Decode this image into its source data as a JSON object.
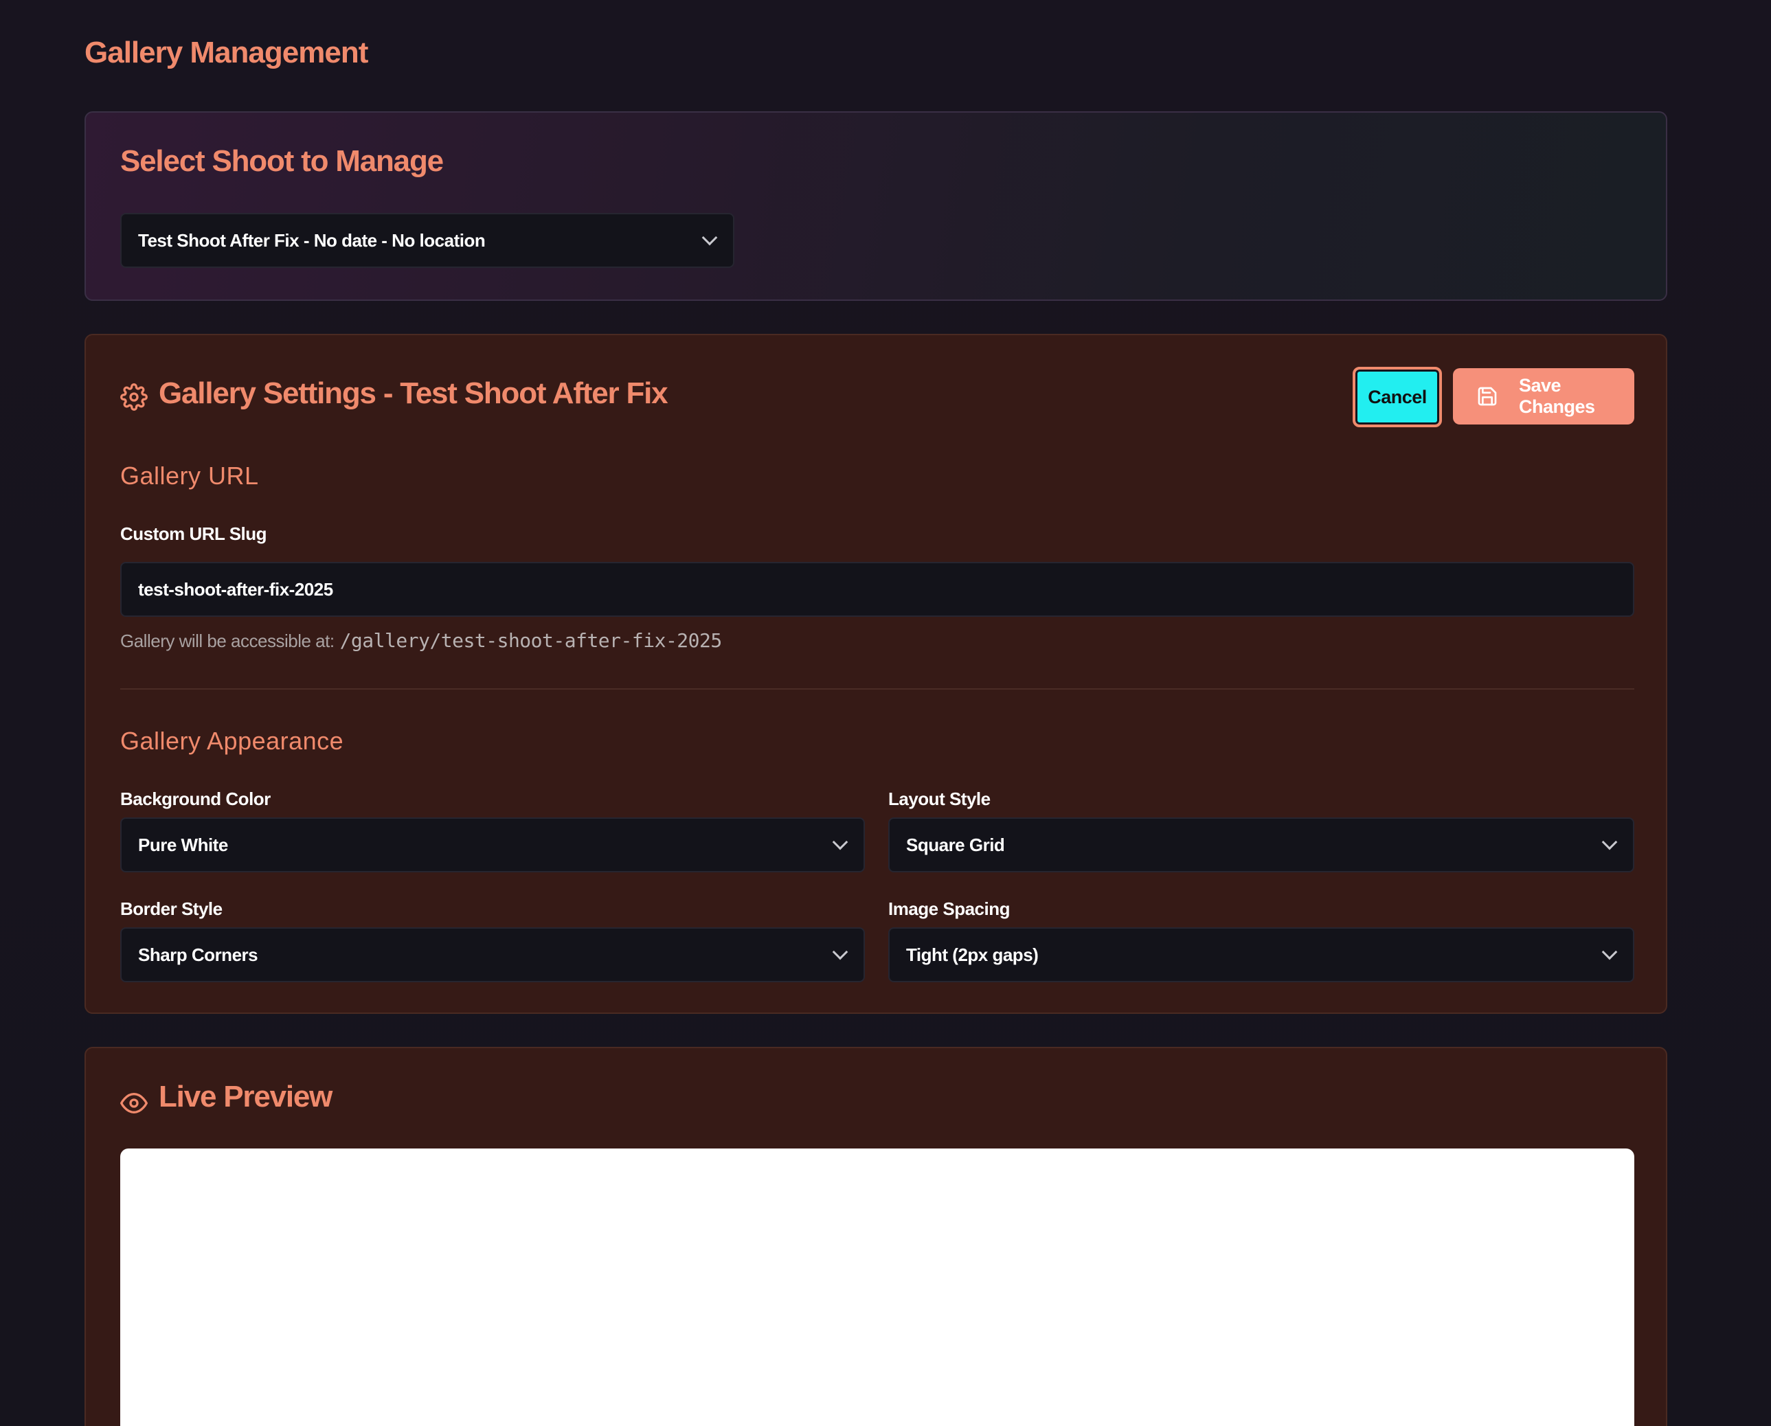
{
  "page": {
    "title": "Gallery Management"
  },
  "select_shoot": {
    "title": "Select Shoot to Manage",
    "selected": "Test Shoot After Fix - No date - No location"
  },
  "settings": {
    "title": "Gallery Settings - Test Shoot After Fix",
    "cancel_label": "Cancel",
    "save_label": "Save Changes",
    "url_section": {
      "heading": "Gallery URL",
      "slug_label": "Custom URL Slug",
      "slug_value": "test-shoot-after-fix-2025",
      "helper_prefix": "Gallery will be accessible at:",
      "helper_path": "/gallery/test-shoot-after-fix-2025"
    },
    "appearance": {
      "heading": "Gallery Appearance",
      "background_color": {
        "label": "Background Color",
        "value": "Pure White"
      },
      "layout_style": {
        "label": "Layout Style",
        "value": "Square Grid"
      },
      "border_style": {
        "label": "Border Style",
        "value": "Sharp Corners"
      },
      "image_spacing": {
        "label": "Image Spacing",
        "value": "Tight (2px gaps)"
      }
    }
  },
  "preview": {
    "title": "Live Preview"
  },
  "colors": {
    "accent": "#f08a6c",
    "cancel_bg": "#22eef0",
    "save_bg": "#f6907a",
    "card_bg": "#361a16",
    "input_bg": "#13131a",
    "page_bg": "#17141f"
  },
  "icons": {
    "settings": "gear-icon",
    "save": "save-icon",
    "preview": "eye-icon",
    "dropdown": "chevron-down-icon"
  }
}
